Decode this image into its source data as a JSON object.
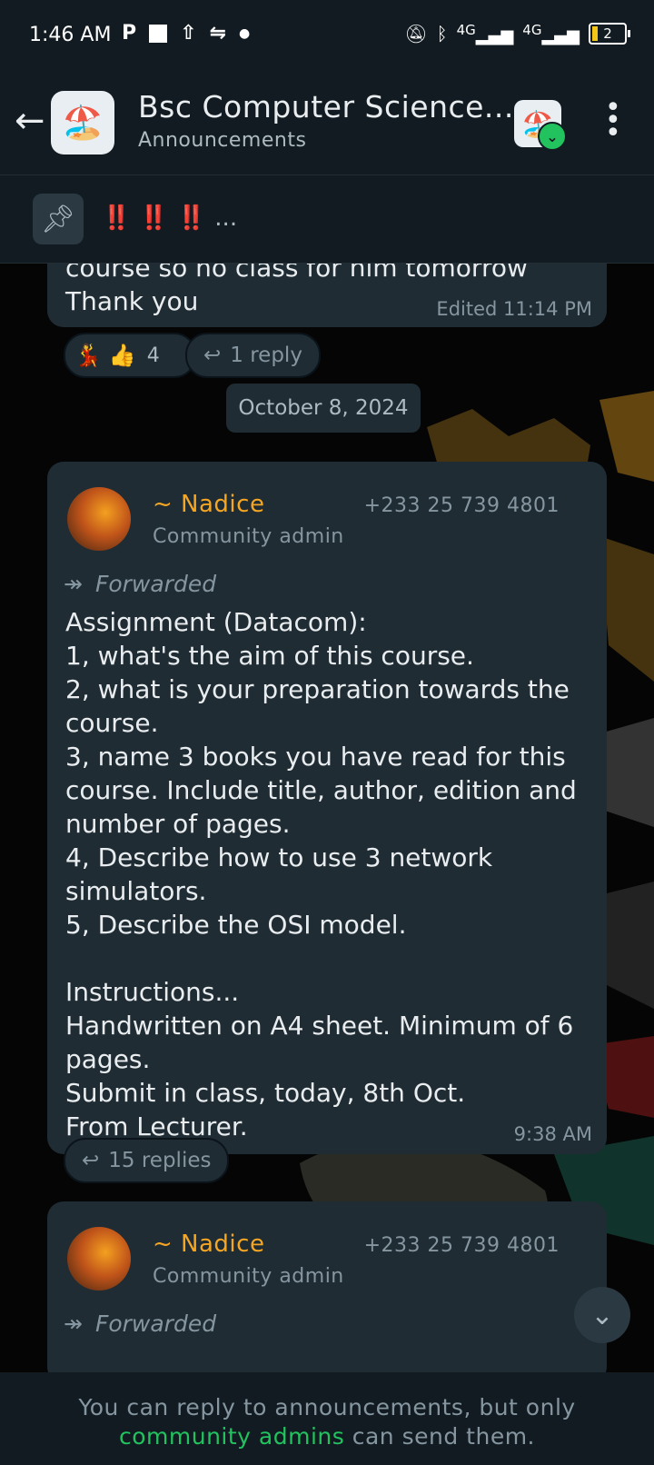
{
  "status_bar": {
    "time": "1:46 AM",
    "left_icons": [
      "parking-icon",
      "square-icon",
      "upload-icon",
      "sync-icon",
      "dot-icon"
    ],
    "right_icons": [
      "mute-icon",
      "bluetooth-icon",
      "signal-4g-icon",
      "signal-4g-icon"
    ],
    "network_label_1": "4G",
    "network_label_2": "4G",
    "battery_level": "2"
  },
  "header": {
    "title": "Bsc Computer Science...",
    "subtitle": "Announcements"
  },
  "pinned": {
    "text": "‼️ ‼️ ‼️",
    "ellipsis": "..."
  },
  "messages": [
    {
      "text": "course so no class for him tomorrow\nThank you",
      "time": "Edited 11:14 PM",
      "reactions": [
        "💃",
        "👍"
      ],
      "reaction_count": "4",
      "replies": "1 reply"
    }
  ],
  "date_chip": "October 8, 2024",
  "post": {
    "sender_name": "~ Nadice",
    "sender_role": "Community admin",
    "sender_phone": "+233 25 739 4801",
    "forwarded_label": "Forwarded",
    "text": "Assignment (Datacom):\n1, what's the aim of this course.\n2, what is your preparation towards the course.\n3, name 3 books you have read for this course. Include title, author, edition and number of pages.\n4, Describe how to use 3 network simulators.\n5, Describe the OSI model.\n\nInstructions...\nHandwritten on A4 sheet. Minimum of 6 pages.\nSubmit in class, today, 8th Oct.\nFrom Lecturer.",
    "time": "9:38 AM",
    "replies": "15 replies"
  },
  "post2": {
    "sender_name": "~ Nadice",
    "sender_role": "Community admin",
    "sender_phone": "+233 25 739 4801",
    "forwarded_label": "Forwarded"
  },
  "footer": {
    "line1": "You can reply to announcements, but only",
    "link": "community admins",
    "line2_rest": " can send them."
  },
  "colors": {
    "accent_green": "#22c35e",
    "sender_name": "#f5a623",
    "bubble": "#1f2c34",
    "header": "#111b21"
  }
}
